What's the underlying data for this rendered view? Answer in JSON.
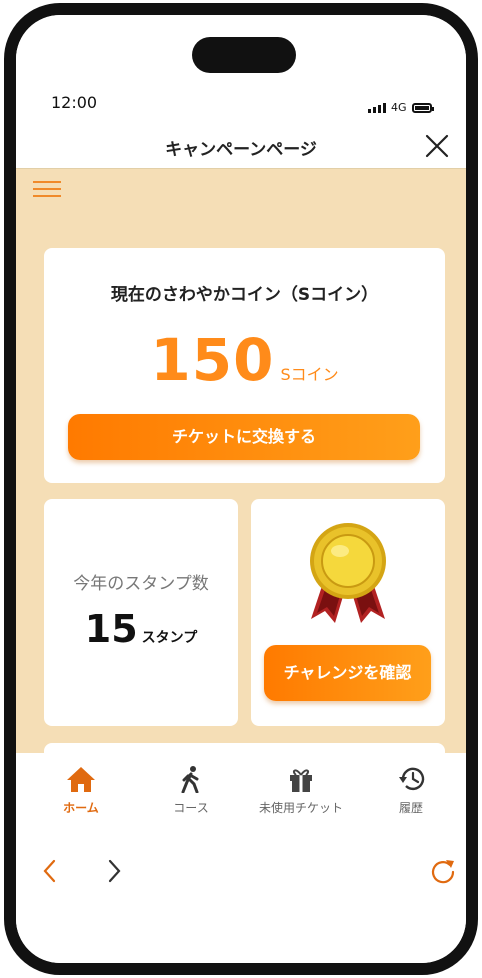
{
  "status": {
    "time": "12:00",
    "network": "4G"
  },
  "header": {
    "title": "キャンペーンページ"
  },
  "coin": {
    "title": "現在のさわやかコイン（Sコイン）",
    "value": "150",
    "unit": "Sコイン",
    "button_label": "チケットに交換する"
  },
  "stamps": {
    "label": "今年のスタンプ数",
    "value": "15",
    "unit": "スタンプ"
  },
  "challenge": {
    "button_label": "チャレンジを確認"
  },
  "tabs": [
    {
      "label": "ホーム",
      "icon": "home-icon",
      "active": true
    },
    {
      "label": "コース",
      "icon": "walker-icon",
      "active": false
    },
    {
      "label": "未使用チケット",
      "icon": "gift-icon",
      "active": false
    },
    {
      "label": "履歴",
      "icon": "history-icon",
      "active": false
    }
  ],
  "colors": {
    "accent": "#ff8b1a",
    "background": "#f5deb6",
    "active_tab": "#e06a10",
    "nav_accent": "#e06a10"
  }
}
